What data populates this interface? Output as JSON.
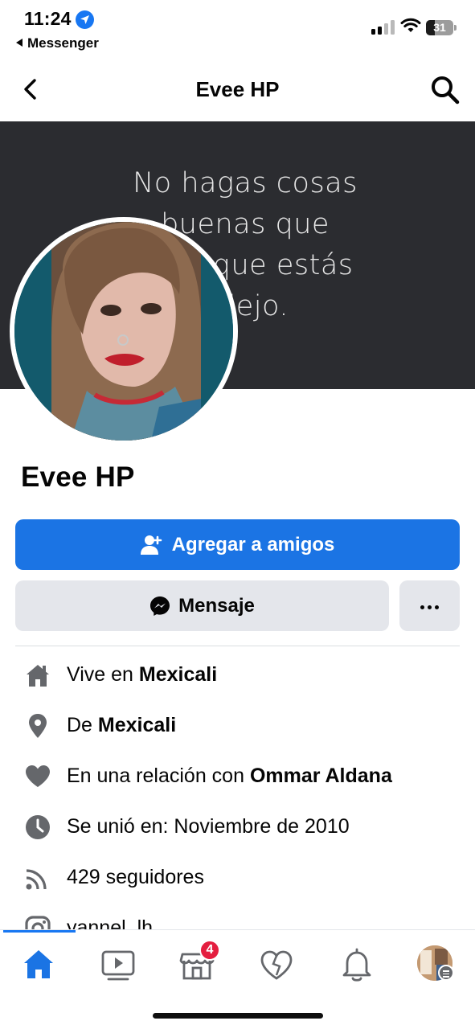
{
  "status_bar": {
    "time": "11:24",
    "back_app": "Messenger",
    "battery": "31"
  },
  "header": {
    "title": "Evee HP",
    "back_icon": "chevron-left-icon",
    "search_icon": "search-icon"
  },
  "cover": {
    "lines": [
      "No hagas cosas",
      "buenas que",
      "n que estás",
      "dejo."
    ]
  },
  "profile": {
    "name": "Evee HP"
  },
  "actions": {
    "add_friend": "Agregar a amigos",
    "message": "Mensaje",
    "more_icon": "more-dots-icon"
  },
  "info": [
    {
      "icon": "home-icon",
      "prefix": "Vive en ",
      "value": "Mexicali"
    },
    {
      "icon": "location-pin-icon",
      "prefix": "De ",
      "value": "Mexicali"
    },
    {
      "icon": "heart-icon",
      "prefix": "En una relación con ",
      "value": "Ommar Aldana"
    },
    {
      "icon": "clock-icon",
      "prefix": "Se unió en: Noviembre de 2010",
      "value": ""
    },
    {
      "icon": "rss-icon",
      "prefix": "429 seguidores",
      "value": ""
    },
    {
      "icon": "instagram-icon",
      "prefix": "yannel_lh",
      "value": ""
    }
  ],
  "tabbar": {
    "marketplace_badge": "4",
    "tabs": [
      "home-icon",
      "video-icon",
      "marketplace-icon",
      "dating-icon",
      "bell-icon",
      "profile-avatar"
    ]
  },
  "colors": {
    "brand_blue": "#1b74e4",
    "secondary_button": "#e4e6eb",
    "cover_bg": "#2b2c30",
    "badge_red": "#e41e3f",
    "icon_gray": "#65676b"
  }
}
